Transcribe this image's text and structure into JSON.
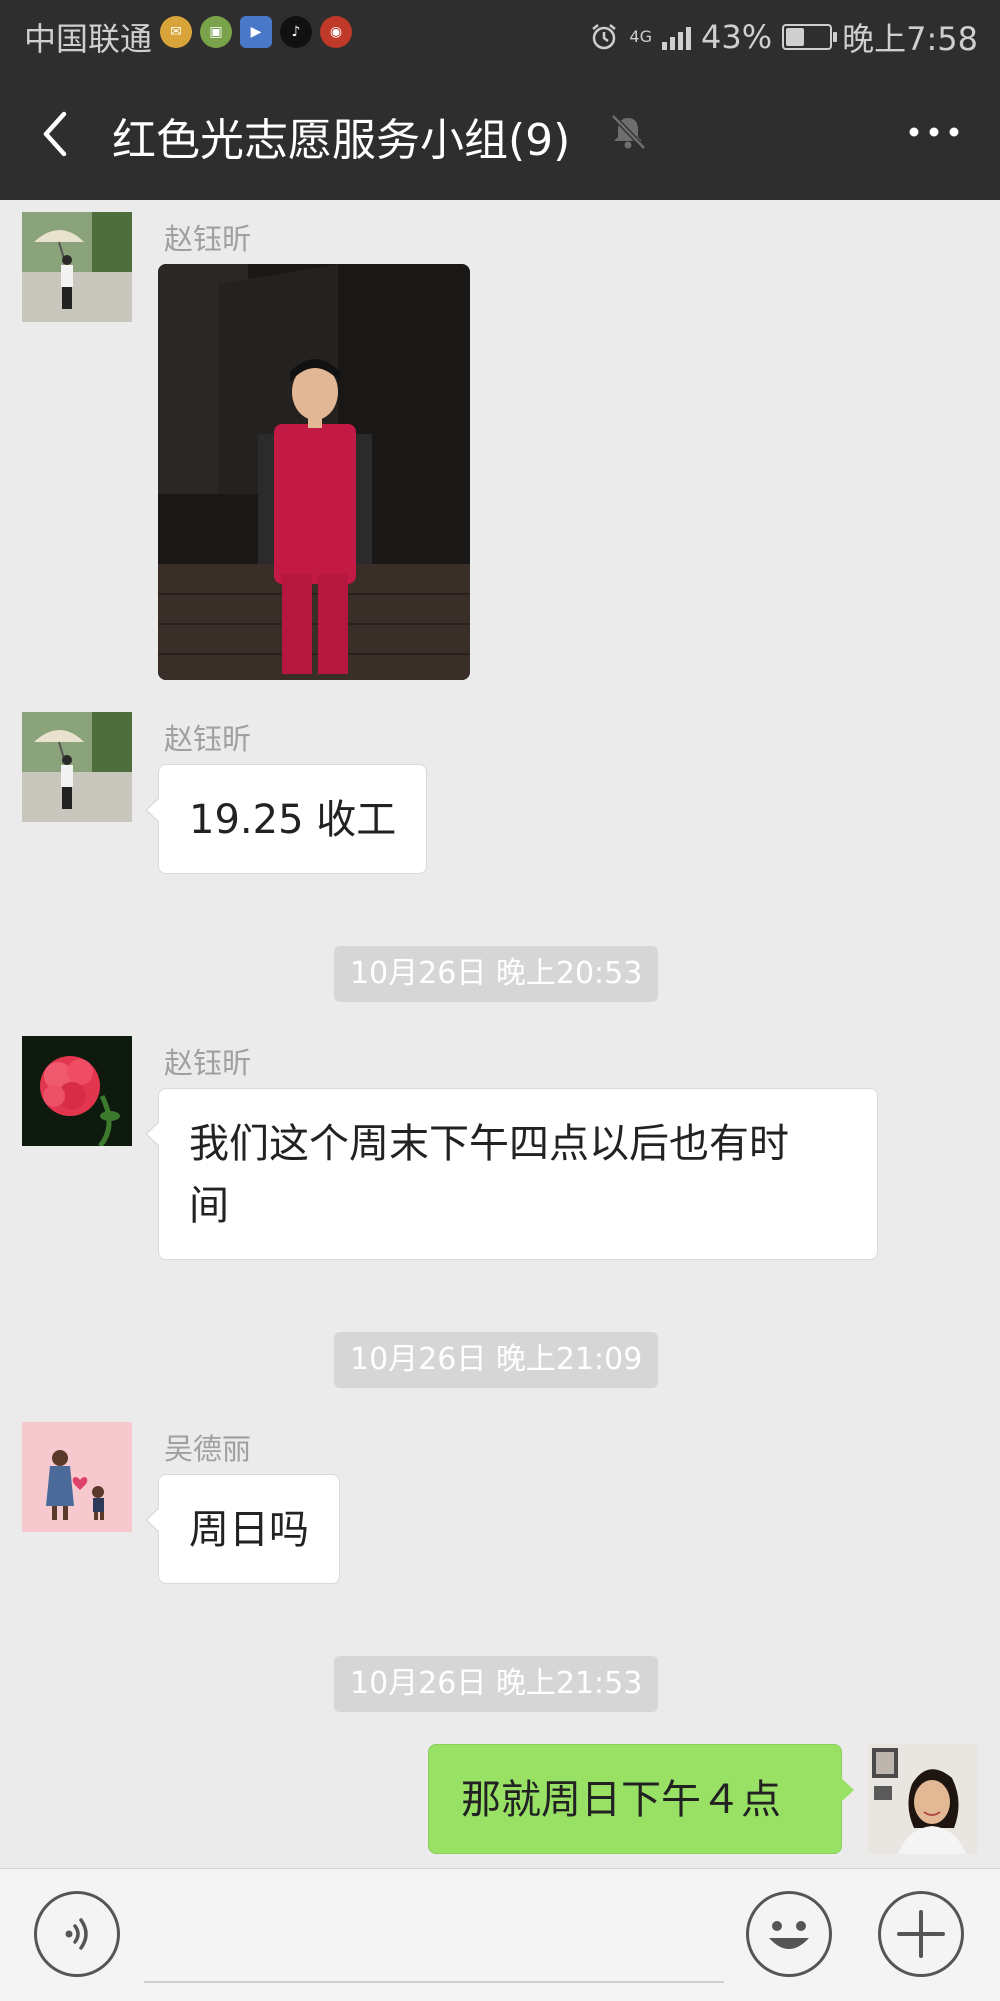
{
  "status_bar": {
    "carrier": "中国联通",
    "battery_text": "43%",
    "battery_level": 0.43,
    "network": "4G",
    "time": "晚上7:58",
    "app_icons": [
      "mail-app-icon",
      "wallet-app-icon",
      "video-app-icon",
      "tiktok-icon",
      "news-app-icon"
    ]
  },
  "header": {
    "title": "红色光志愿服务小组(9)",
    "back_icon": "chevron-left-icon",
    "mute_icon": "bell-off-icon",
    "more_icon": "more-dots-icon"
  },
  "messages": [
    {
      "type": "image",
      "sender": "赵钰昕",
      "avatar": "umbrella-person-avatar",
      "image": "volunteer-in-red-vest-photo"
    },
    {
      "type": "text",
      "sender": "赵钰昕",
      "avatar": "umbrella-person-avatar",
      "text": "19.25 收工"
    },
    {
      "type": "timestamp",
      "text": "10月26日 晚上20:53"
    },
    {
      "type": "text",
      "sender": "赵钰昕",
      "avatar": "red-carnation-avatar",
      "text_line1": "我们这个周末下午四点以后也有时",
      "text_line2": "间"
    },
    {
      "type": "timestamp",
      "text": "10月26日 晚上21:09"
    },
    {
      "type": "text",
      "sender": "吴德丽",
      "avatar": "cartoon-heart-avatar",
      "text": "周日吗"
    },
    {
      "type": "timestamp",
      "text": "10月26日 晚上21:53"
    },
    {
      "type": "text",
      "outgoing": true,
      "avatar": "woman-selfie-avatar",
      "text": "那就周日下午４点"
    }
  ],
  "input_bar": {
    "voice_icon": "voice-input-icon",
    "emoji_icon": "emoji-icon",
    "plus_icon": "plus-icon"
  },
  "colors": {
    "header_bg": "#2e2e2e",
    "chat_bg": "#ebebeb",
    "outgoing_bubble": "#98e165",
    "incoming_bubble": "#ffffff"
  }
}
